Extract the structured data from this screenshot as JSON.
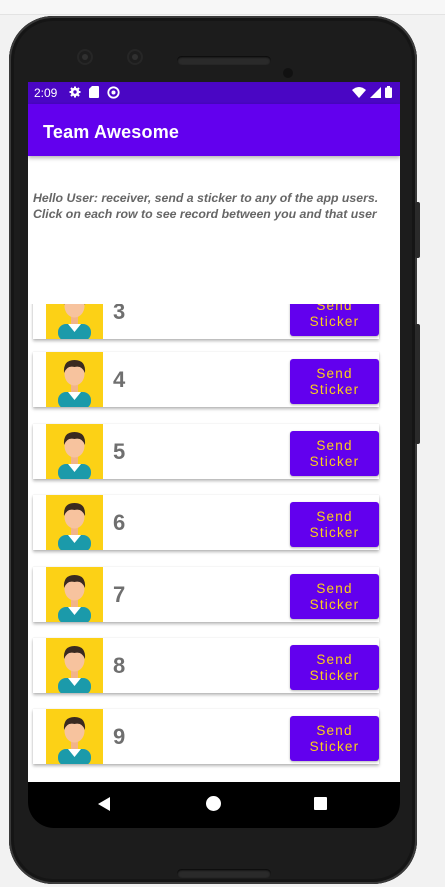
{
  "status_bar": {
    "time": "2:09",
    "icons": [
      "gear-icon",
      "sd-card-icon",
      "sync-icon"
    ],
    "right_icons": [
      "wifi-icon",
      "signal-icon",
      "battery-icon"
    ]
  },
  "app_bar": {
    "title": "Team Awesome"
  },
  "intro_text": "Hello User: receiver, send a sticker to any of the app users. Click on each row to see record between you and that user",
  "users": [
    {
      "number": "3",
      "button_line1": "Send",
      "button_line2": "Sticker"
    },
    {
      "number": "4",
      "button_line1": "Send",
      "button_line2": "Sticker"
    },
    {
      "number": "5",
      "button_line1": "Send",
      "button_line2": "Sticker"
    },
    {
      "number": "6",
      "button_line1": "Send",
      "button_line2": "Sticker"
    },
    {
      "number": "7",
      "button_line1": "Send",
      "button_line2": "Sticker"
    },
    {
      "number": "8",
      "button_line1": "Send",
      "button_line2": "Sticker"
    },
    {
      "number": "9",
      "button_line1": "Send",
      "button_line2": "Sticker"
    }
  ],
  "nav_bar": [
    "back-icon",
    "home-icon",
    "recents-icon"
  ],
  "colors": {
    "primary": "#6200ee",
    "status_bar": "#4a06c4",
    "accent": "#fcd116"
  }
}
